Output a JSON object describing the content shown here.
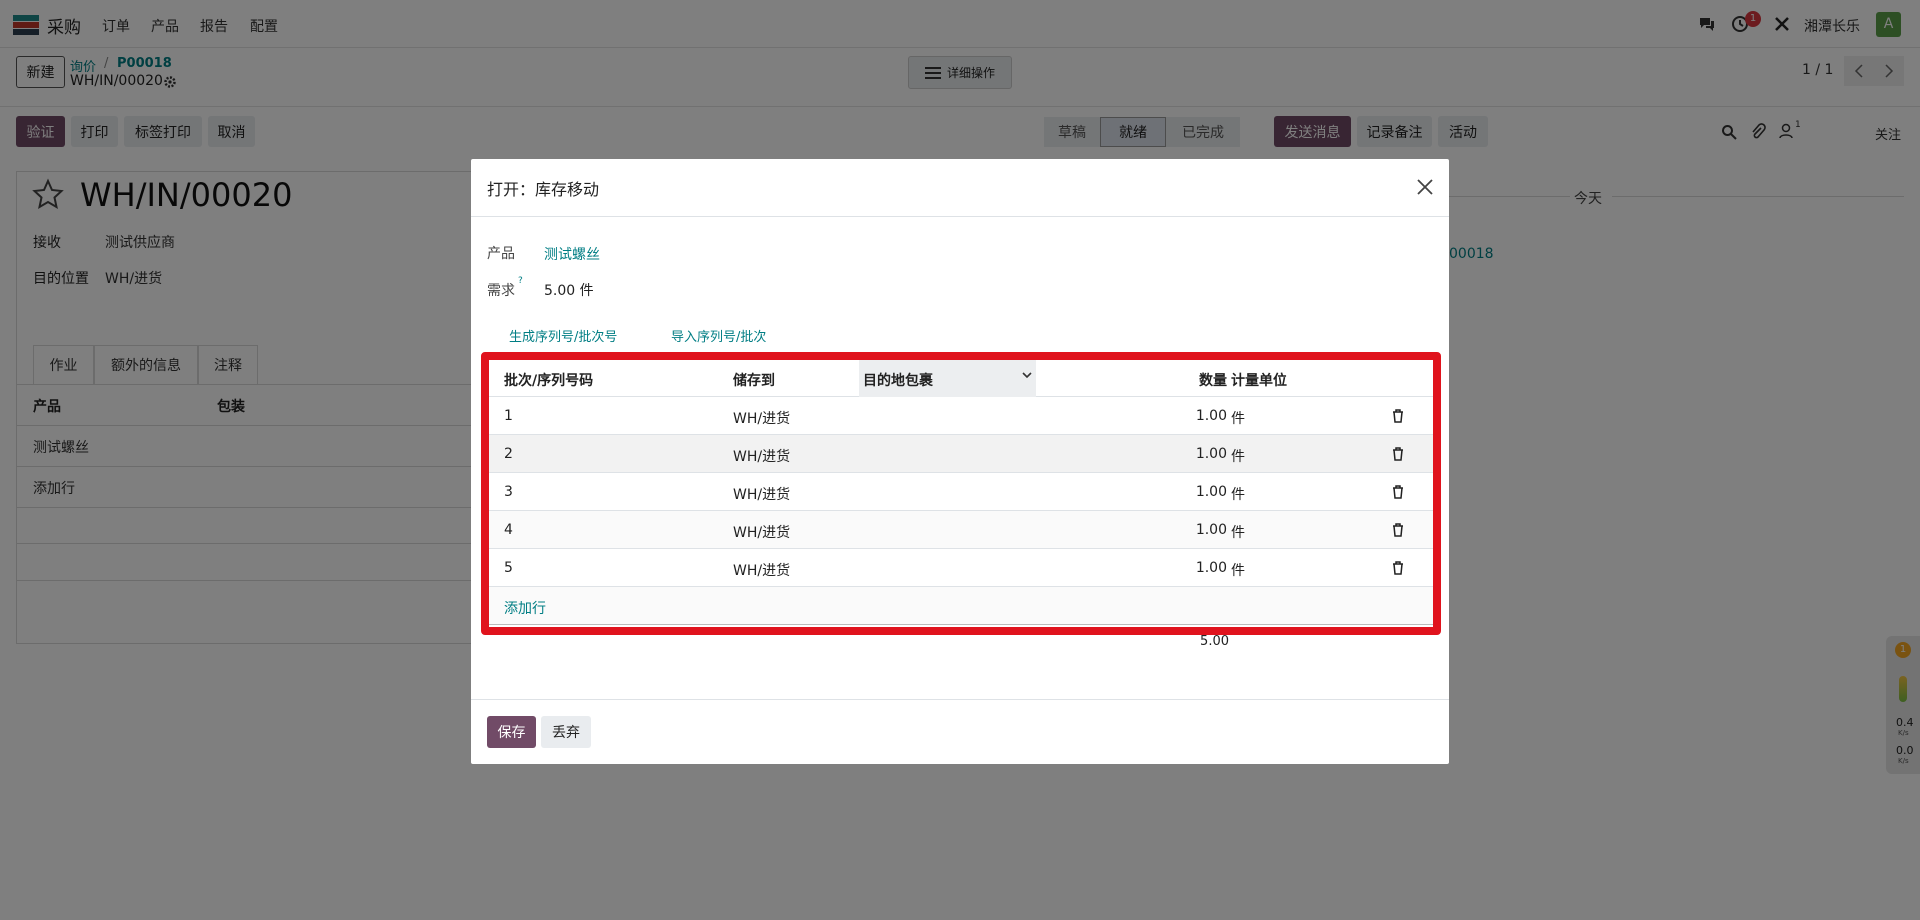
{
  "topbar": {
    "app_name": "采购",
    "menu": [
      "订单",
      "产品",
      "报告",
      "配置"
    ],
    "user_name": "湘潭长乐",
    "avatar_letter": "A",
    "activity_count": "1"
  },
  "control": {
    "new_button": "新建",
    "breadcrumb_parent": "询价",
    "breadcrumb_sep": "/",
    "breadcrumb_po": "P00018",
    "record_name": "WH/IN/00020",
    "actions_button": "详细操作",
    "pager": "1 / 1"
  },
  "statusbar": {
    "buttons": [
      "验证",
      "打印",
      "标签打印",
      "取消"
    ],
    "stages": [
      "草稿",
      "就绪",
      "已完成"
    ],
    "active_stage": "就绪",
    "chatter_buttons": [
      "发送消息",
      "记录备注",
      "活动"
    ],
    "follower_count": "1",
    "follow_label": "关注"
  },
  "form": {
    "title": "WH/IN/00020",
    "receive_label": "接收",
    "receive_value": "测试供应商",
    "dest_label": "目的位置",
    "dest_value": "WH/进货",
    "tabs": [
      "作业",
      "额外的信息",
      "注释"
    ],
    "col_product": "产品",
    "col_package": "包装",
    "line_product": "测试螺丝",
    "add_line": "添加行"
  },
  "chatter": {
    "today": "今天",
    "po_ref": "00018"
  },
  "modal": {
    "title": "打开：库存移动",
    "product_label": "产品",
    "product_value": "测试螺丝",
    "demand_label": "需求",
    "demand_help": "?",
    "demand_value": "5.00 件",
    "generate_link": "生成序列号/批次号",
    "import_link": "导入序列号/批次",
    "columns": {
      "lot": "批次/序列号码",
      "store_to": "储存到",
      "dest_package": "目的地包裹",
      "qty": "数量",
      "uom": "计量单位"
    },
    "rows": [
      {
        "lot": "1",
        "loc": "WH/进货",
        "qty": "1.00",
        "uom": "件"
      },
      {
        "lot": "2",
        "loc": "WH/进货",
        "qty": "1.00",
        "uom": "件"
      },
      {
        "lot": "3",
        "loc": "WH/进货",
        "qty": "1.00",
        "uom": "件"
      },
      {
        "lot": "4",
        "loc": "WH/进货",
        "qty": "1.00",
        "uom": "件"
      },
      {
        "lot": "5",
        "loc": "WH/进货",
        "qty": "1.00",
        "uom": "件"
      }
    ],
    "add_line": "添加行",
    "total": "5.00",
    "save_button": "保存",
    "discard_button": "丢弃"
  },
  "widget": {
    "badge": "1",
    "up_value": "0.4",
    "up_unit": "K/s",
    "down_value": "0.0",
    "down_unit": "K/s"
  },
  "colors": {
    "brand": "#714b67",
    "link": "#017e84",
    "highlight_frame": "#e0131d"
  }
}
